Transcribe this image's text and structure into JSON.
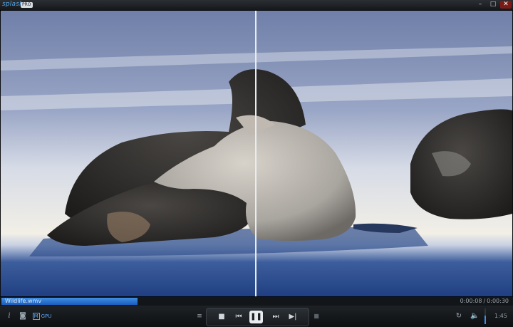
{
  "app": {
    "logo": "splash",
    "edition": "PRO",
    "window_buttons": {
      "minimize": "–",
      "maximize": "□",
      "close": "✕"
    }
  },
  "video": {
    "description": "sea lions on beach"
  },
  "progress": {
    "file_name": "Wildlife.wmv",
    "elapsed": "0:00:08",
    "total": "0:00:30",
    "separator": "/",
    "played_fraction": 0.267
  },
  "controls": {
    "info": "i",
    "camera": "◙",
    "gpu": {
      "m": "M",
      "label": "GPU"
    },
    "equalizer": "≡",
    "stop": "■",
    "previous": "⏮",
    "pause": "❚❚",
    "next": "⏭",
    "step": "▶|",
    "playlist": "■",
    "repeat": "↻",
    "volume": "🔈",
    "volume_level": 0.55,
    "clock": "1:45"
  },
  "colors": {
    "accent": "#3f8fe3",
    "close": "#7c1b16"
  }
}
